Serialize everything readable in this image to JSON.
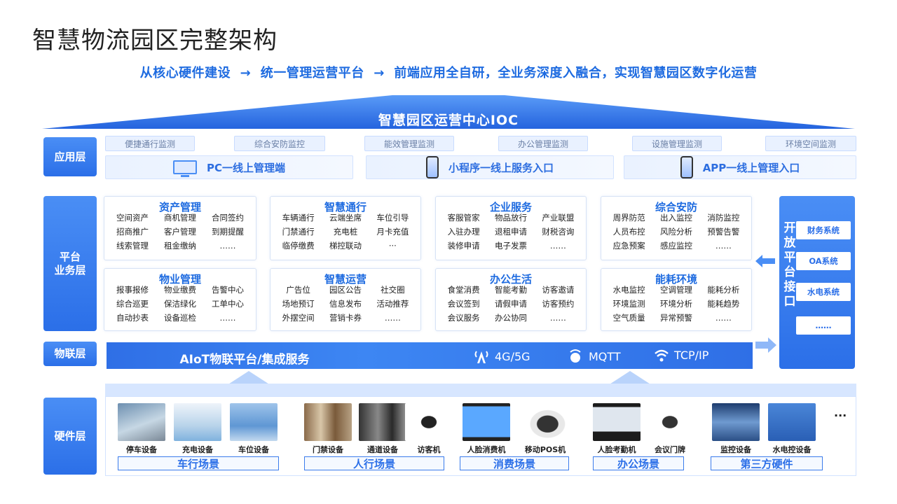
{
  "title": "智慧物流园区完整架构",
  "subtitle": "从核心硬件建设  →  统一管理运营平台  →  前端应用全自研，全业务深度入融合，实现智慧园区数字化运营",
  "ioc_label": "智慧园区运营中心IOC",
  "layers": {
    "app": "应用层",
    "platform": "平台\n业务层",
    "iot": "物联层",
    "hardware": "硬件层"
  },
  "app_tags": [
    "便捷通行监测",
    "综合安防监控",
    "能效管理监测",
    "办公管理监测",
    "设施管理监测",
    "环境空间监测"
  ],
  "app_entries": [
    "PC一线上管理端",
    "小程序一线上服务入口",
    "APP一线上管理入口"
  ],
  "modules": [
    {
      "title": "资产管理",
      "items": [
        "空间资产",
        "商机管理",
        "合同签约",
        "招商推广",
        "客户管理",
        "到期提醒",
        "线索管理",
        "租金缴纳",
        "……"
      ]
    },
    {
      "title": "智慧通行",
      "items": [
        "车辆通行",
        "云端坐席",
        "车位引导",
        "门禁通行",
        "充电桩",
        "月卡充值",
        "临停缴费",
        "梯控联动",
        "···"
      ]
    },
    {
      "title": "企业服务",
      "items": [
        "客服管家",
        "物品放行",
        "产业联盟",
        "入驻办理",
        "退租申请",
        "财税咨询",
        "装修申请",
        "电子发票",
        "……"
      ]
    },
    {
      "title": "综合安防",
      "items": [
        "周界防范",
        "出入监控",
        "消防监控",
        "人员布控",
        "风险分析",
        "预警告警",
        "应急预案",
        "感应监控",
        "……"
      ]
    },
    {
      "title": "物业管理",
      "items": [
        "报事报修",
        "物业缴费",
        "告警中心",
        "综合巡更",
        "保洁绿化",
        "工单中心",
        "自动抄表",
        "设备巡检",
        "……"
      ]
    },
    {
      "title": "智慧运营",
      "items": [
        "广告位",
        "园区公告",
        "社交圈",
        "场地预订",
        "信息发布",
        "活动推荐",
        "外摆空间",
        "营销卡券",
        "……"
      ]
    },
    {
      "title": "办公生活",
      "items": [
        "食堂消费",
        "智能考勤",
        "访客邀请",
        "会议签到",
        "请假申请",
        "访客预约",
        "会议服务",
        "办公协同",
        "……"
      ]
    },
    {
      "title": "能耗环境",
      "items": [
        "水电监控",
        "空调管理",
        "能耗分析",
        "环境监测",
        "环境分析",
        "能耗趋势",
        "空气质量",
        "异常预警",
        "……"
      ]
    }
  ],
  "open_platform": {
    "title": "开放平台接口",
    "items": [
      "财务系统",
      "OA系统",
      "水电系统",
      "……"
    ]
  },
  "iot": {
    "title": "AIoT物联平台/集成服务",
    "protocols": [
      "4G/5G",
      "MQTT",
      "TCP/IP"
    ]
  },
  "hardware": {
    "devices": [
      "停车设备",
      "充电设备",
      "车位设备",
      "门禁设备",
      "通道设备",
      "访客机",
      "人脸消费机",
      "移动POS机",
      "人脸考勤机",
      "会议门牌",
      "监控设备",
      "水电控设备"
    ],
    "scenes": [
      "车行场景",
      "人行场景",
      "消费场景",
      "办公场景",
      "第三方硬件"
    ],
    "more": "···"
  },
  "colors": {
    "primary": "#2b6fe8",
    "accent_text": "#1e6be0",
    "light_bg": "#e9f1ff"
  }
}
